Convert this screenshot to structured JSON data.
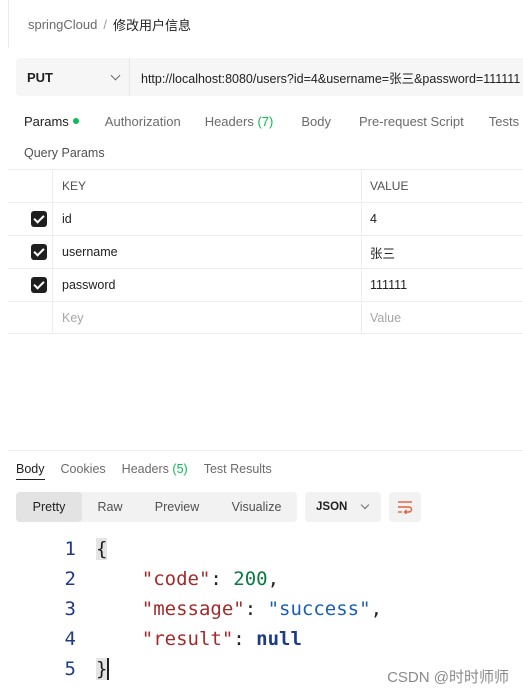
{
  "breadcrumb": {
    "collection": "springCloud",
    "separator": "/",
    "request": "修改用户信息"
  },
  "request": {
    "method": "PUT",
    "url": "http://localhost:8080/users?id=4&username=张三&password=111111"
  },
  "request_tabs": [
    {
      "label": "Params",
      "active": true,
      "dot": true
    },
    {
      "label": "Authorization"
    },
    {
      "label": "Headers",
      "count": "(7)"
    },
    {
      "label": "Body"
    },
    {
      "label": "Pre-request Script"
    },
    {
      "label": "Tests"
    }
  ],
  "query_params": {
    "title": "Query Params",
    "headers": {
      "key": "KEY",
      "value": "VALUE"
    },
    "rows": [
      {
        "key": "id",
        "value": "4",
        "checked": true
      },
      {
        "key": "username",
        "value": "张三",
        "checked": true
      },
      {
        "key": "password",
        "value": "111111",
        "checked": true
      }
    ],
    "placeholder": {
      "key": "Key",
      "value": "Value"
    }
  },
  "response_tabs": [
    {
      "label": "Body",
      "active": true
    },
    {
      "label": "Cookies"
    },
    {
      "label": "Headers",
      "count": "(5)"
    },
    {
      "label": "Test Results"
    }
  ],
  "view_modes": [
    "Pretty",
    "Raw",
    "Preview",
    "Visualize"
  ],
  "active_view_mode": "Pretty",
  "format": "JSON",
  "wrap_icon": "wrap-lines-icon",
  "response_body": {
    "line_numbers": [
      "1",
      "2",
      "3",
      "4",
      "5"
    ],
    "open_brace": "{",
    "close_brace": "}",
    "code_key": "\"code\"",
    "code_value": "200",
    "message_key": "\"message\"",
    "message_value": "\"success\"",
    "result_key": "\"result\"",
    "result_value": "null"
  },
  "watermark": "CSDN @时时师师",
  "colors": {
    "accent_green": "#0cbb52",
    "key_color": "#a52a2a",
    "string_color": "#1a5fb4",
    "number_color": "#0b7a45"
  }
}
